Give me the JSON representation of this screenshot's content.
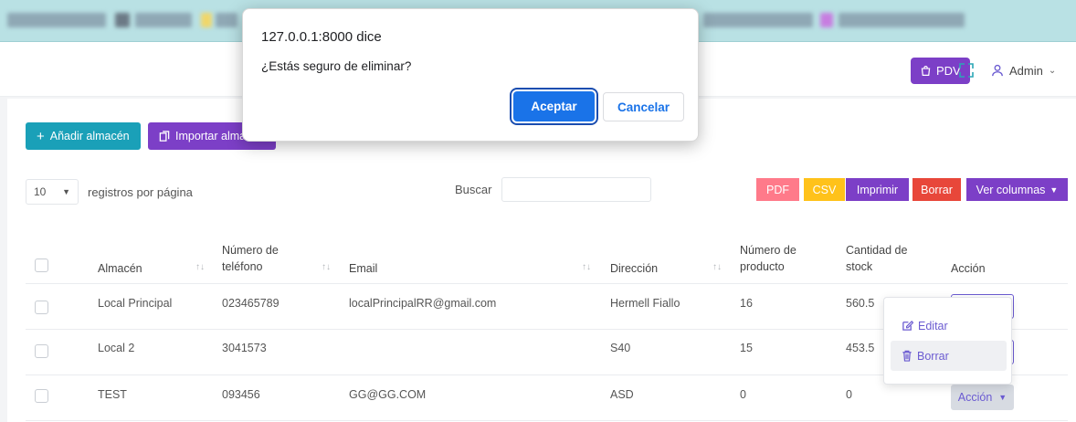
{
  "dialog": {
    "title": "127.0.0.1:8000 dice",
    "message": "¿Estás seguro de eliminar?",
    "ok_label": "Aceptar",
    "cancel_label": "Cancelar"
  },
  "header": {
    "pdv_label": "PDV",
    "user_label": "Admin"
  },
  "toolbar": {
    "add_label": "Añadir almacén",
    "import_label": "Importar almacén"
  },
  "table_controls": {
    "per_page_value": "10",
    "per_page_label": "registros por página",
    "search_label": "Buscar",
    "pdf_label": "PDF",
    "csv_label": "CSV",
    "print_label": "Imprimir",
    "delete_label": "Borrar",
    "columns_label": "Ver columnas"
  },
  "table": {
    "headers": {
      "almacen": "Almacén",
      "telefono_1": "Número de",
      "telefono_2": "teléfono",
      "email": "Email",
      "direccion": "Dirección",
      "producto_1": "Número de",
      "producto_2": "producto",
      "stock_1": "Cantidad de",
      "stock_2": "stock",
      "accion": "Acción"
    },
    "rows": [
      {
        "almacen": "Local Principal",
        "telefono": "023465789",
        "email": "localPrincipalRR@gmail.com",
        "direccion": "Hermell Fiallo",
        "producto": "16",
        "stock": "560.5"
      },
      {
        "almacen": "Local 2",
        "telefono": "3041573",
        "email": "",
        "direccion": "S40",
        "producto": "15",
        "stock": "453.5"
      },
      {
        "almacen": "TEST",
        "telefono": "093456",
        "email": "GG@GG.COM",
        "direccion": "ASD",
        "producto": "0",
        "stock": "0"
      }
    ],
    "action_label": "Acción"
  },
  "dropdown": {
    "edit_label": "Editar",
    "delete_label": "Borrar"
  },
  "colors": {
    "primary_purple": "#7c3fc7",
    "teal": "#1aa0b8",
    "dialog_blue": "#1a73e8"
  }
}
